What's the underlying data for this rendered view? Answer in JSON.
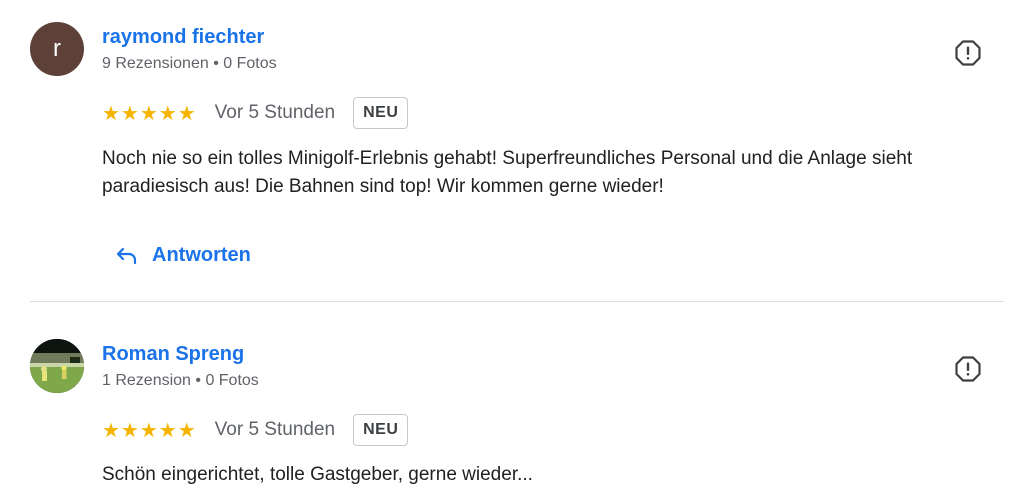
{
  "reviews": [
    {
      "avatar_letter": "r",
      "avatar_color": "#5d4037",
      "name": "raymond fiechter",
      "meta": "9 Rezensionen • 0 Fotos",
      "stars": "★★★★★",
      "rating": 5,
      "time": "Vor 5 Stunden",
      "badge": "NEU",
      "text": "Noch nie so ein tolles Minigolf-Erlebnis gehabt! Superfreundliches Personal und die Anlage sieht paradiesisch aus! Die Bahnen sind top! Wir kommen gerne wieder!",
      "reply_label": "Antworten"
    },
    {
      "name": "Roman Spreng",
      "meta": "1 Rezension • 0 Fotos",
      "stars": "★★★★★",
      "rating": 5,
      "time": "Vor 5 Stunden",
      "badge": "NEU",
      "text": "Schön eingerichtet, tolle Gastgeber, gerne wieder..."
    }
  ],
  "icons": {
    "flag": "report-icon",
    "reply": "reply-arrow-icon"
  },
  "colors": {
    "link": "#1a73e8",
    "star": "#f4b400",
    "secondary_text": "#5f6368"
  }
}
